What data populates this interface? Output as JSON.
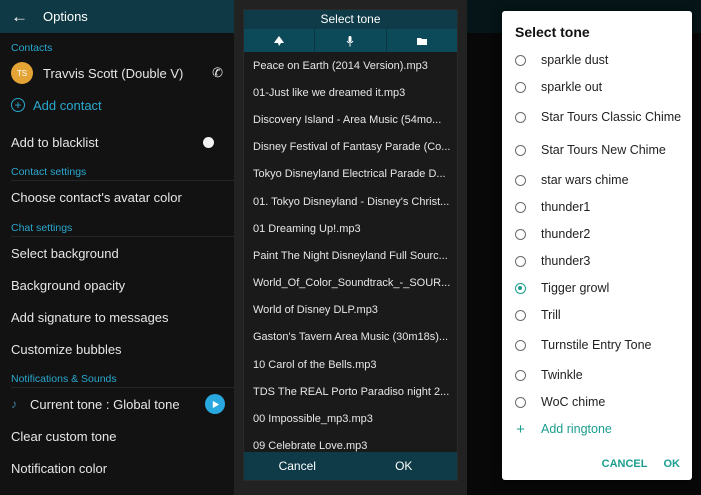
{
  "options": {
    "title": "Options",
    "contacts_header": "Contacts",
    "contact_initials": "TS",
    "contact_name": "Travvis Scott (Double V)",
    "add_contact": "Add contact",
    "add_to_blacklist": "Add to blacklist",
    "contact_settings_header": "Contact settings",
    "choose_avatar_color": "Choose contact's avatar color",
    "chat_settings_header": "Chat settings",
    "select_background": "Select background",
    "background_opacity": "Background opacity",
    "add_signature": "Add signature to messages",
    "customize_bubbles": "Customize bubbles",
    "notifications_header": "Notifications & Sounds",
    "current_tone": "Current tone : Global tone",
    "clear_custom_tone": "Clear custom tone",
    "notification_color": "Notification color"
  },
  "tone_picker": {
    "title": "Select tone",
    "tabs": [
      "bell-icon",
      "mic-icon",
      "folder-icon"
    ],
    "files": [
      "Peace on Earth (2014 Version).mp3",
      "01-Just like we dreamed it.mp3",
      "Discovery Island - Area Music (54mo...",
      "Disney Festival of Fantasy Parade (Co...",
      "Tokyo Disneyland Electrical Parade D...",
      "01. Tokyo Disneyland - Disney's Christ...",
      "01 Dreaming Up!.mp3",
      "Paint The Night Disneyland Full Sourc...",
      "World_Of_Color_Soundtrack_-_SOUR...",
      "World of Disney DLP.mp3",
      "Gaston's Tavern Area Music (30m18s)...",
      "10 Carol of the Bells.mp3",
      "TDS The REAL Porto Paradiso night 2...",
      "00 Impossible_mp3.mp3",
      "09 Celebrate Love.mp3"
    ],
    "cancel": "Cancel",
    "ok": "OK"
  },
  "ringtone_dialog": {
    "title": "Select tone",
    "items": [
      {
        "label": "sparkle dust",
        "selected": false
      },
      {
        "label": "sparkle out",
        "selected": false
      },
      {
        "label": "Star Tours Classic Chime",
        "selected": false
      },
      {
        "label": "Star Tours New Chime",
        "selected": false
      },
      {
        "label": "star wars chime",
        "selected": false
      },
      {
        "label": "thunder1",
        "selected": false
      },
      {
        "label": "thunder2",
        "selected": false
      },
      {
        "label": "thunder3",
        "selected": false
      },
      {
        "label": "Tigger growl",
        "selected": true
      },
      {
        "label": "Trill",
        "selected": false
      },
      {
        "label": "Turnstile Entry Tone",
        "selected": false
      },
      {
        "label": "Twinkle",
        "selected": false
      },
      {
        "label": "WoC chime",
        "selected": false
      }
    ],
    "add_ringtone": "Add ringtone",
    "cancel": "CANCEL",
    "ok": "OK"
  },
  "colors": {
    "accent_blue": "#29a8cf",
    "appbar": "#0f3a45",
    "teal": "#1b9e8e",
    "avatar": "#e3a335"
  }
}
